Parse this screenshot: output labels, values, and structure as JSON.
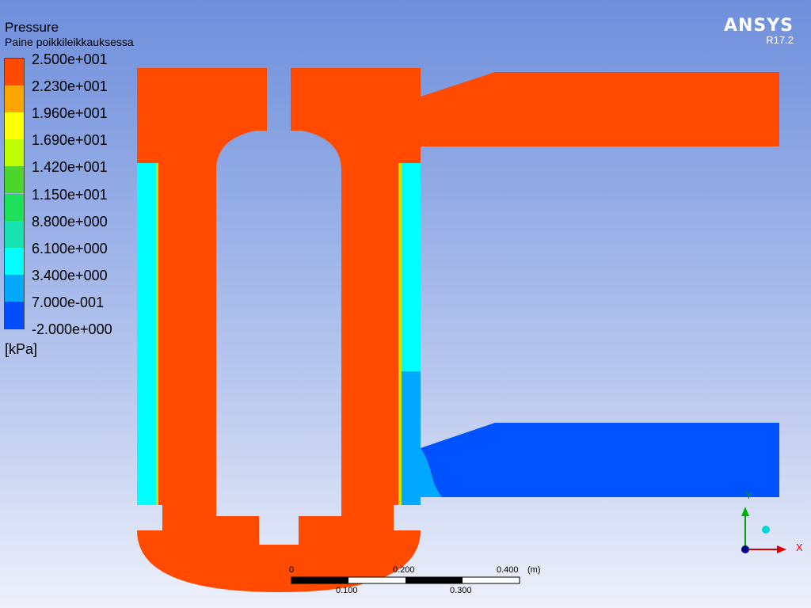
{
  "legend": {
    "title": "Pressure",
    "subtitle": "Paine poikkileikkauksessa",
    "unit": "[kPa]",
    "labels": [
      "2.500e+001",
      "2.230e+001",
      "1.960e+001",
      "1.690e+001",
      "1.420e+001",
      "1.150e+001",
      "8.800e+000",
      "6.100e+000",
      "3.400e+000",
      "7.000e-001",
      "-2.000e+000"
    ],
    "colors": [
      "#ff4a00",
      "#ffa500",
      "#ffff00",
      "#bfff00",
      "#4cd62b",
      "#1fe05a",
      "#18e2b0",
      "#00ffff",
      "#00a8ff",
      "#004cff"
    ]
  },
  "logo": {
    "name": "ANSYS",
    "version": "R17.2"
  },
  "scale": {
    "top_labels": [
      "0",
      "0.200",
      "0.400",
      "(m)"
    ],
    "bottom_labels": [
      "0.100",
      "0.300"
    ]
  },
  "axes": {
    "x_label": "X",
    "y_label": "Y"
  },
  "contour_colors": {
    "high": "#ff4a00",
    "cyan": "#00ffff",
    "light_blue": "#00a8ff",
    "blue": "#0052ff"
  }
}
